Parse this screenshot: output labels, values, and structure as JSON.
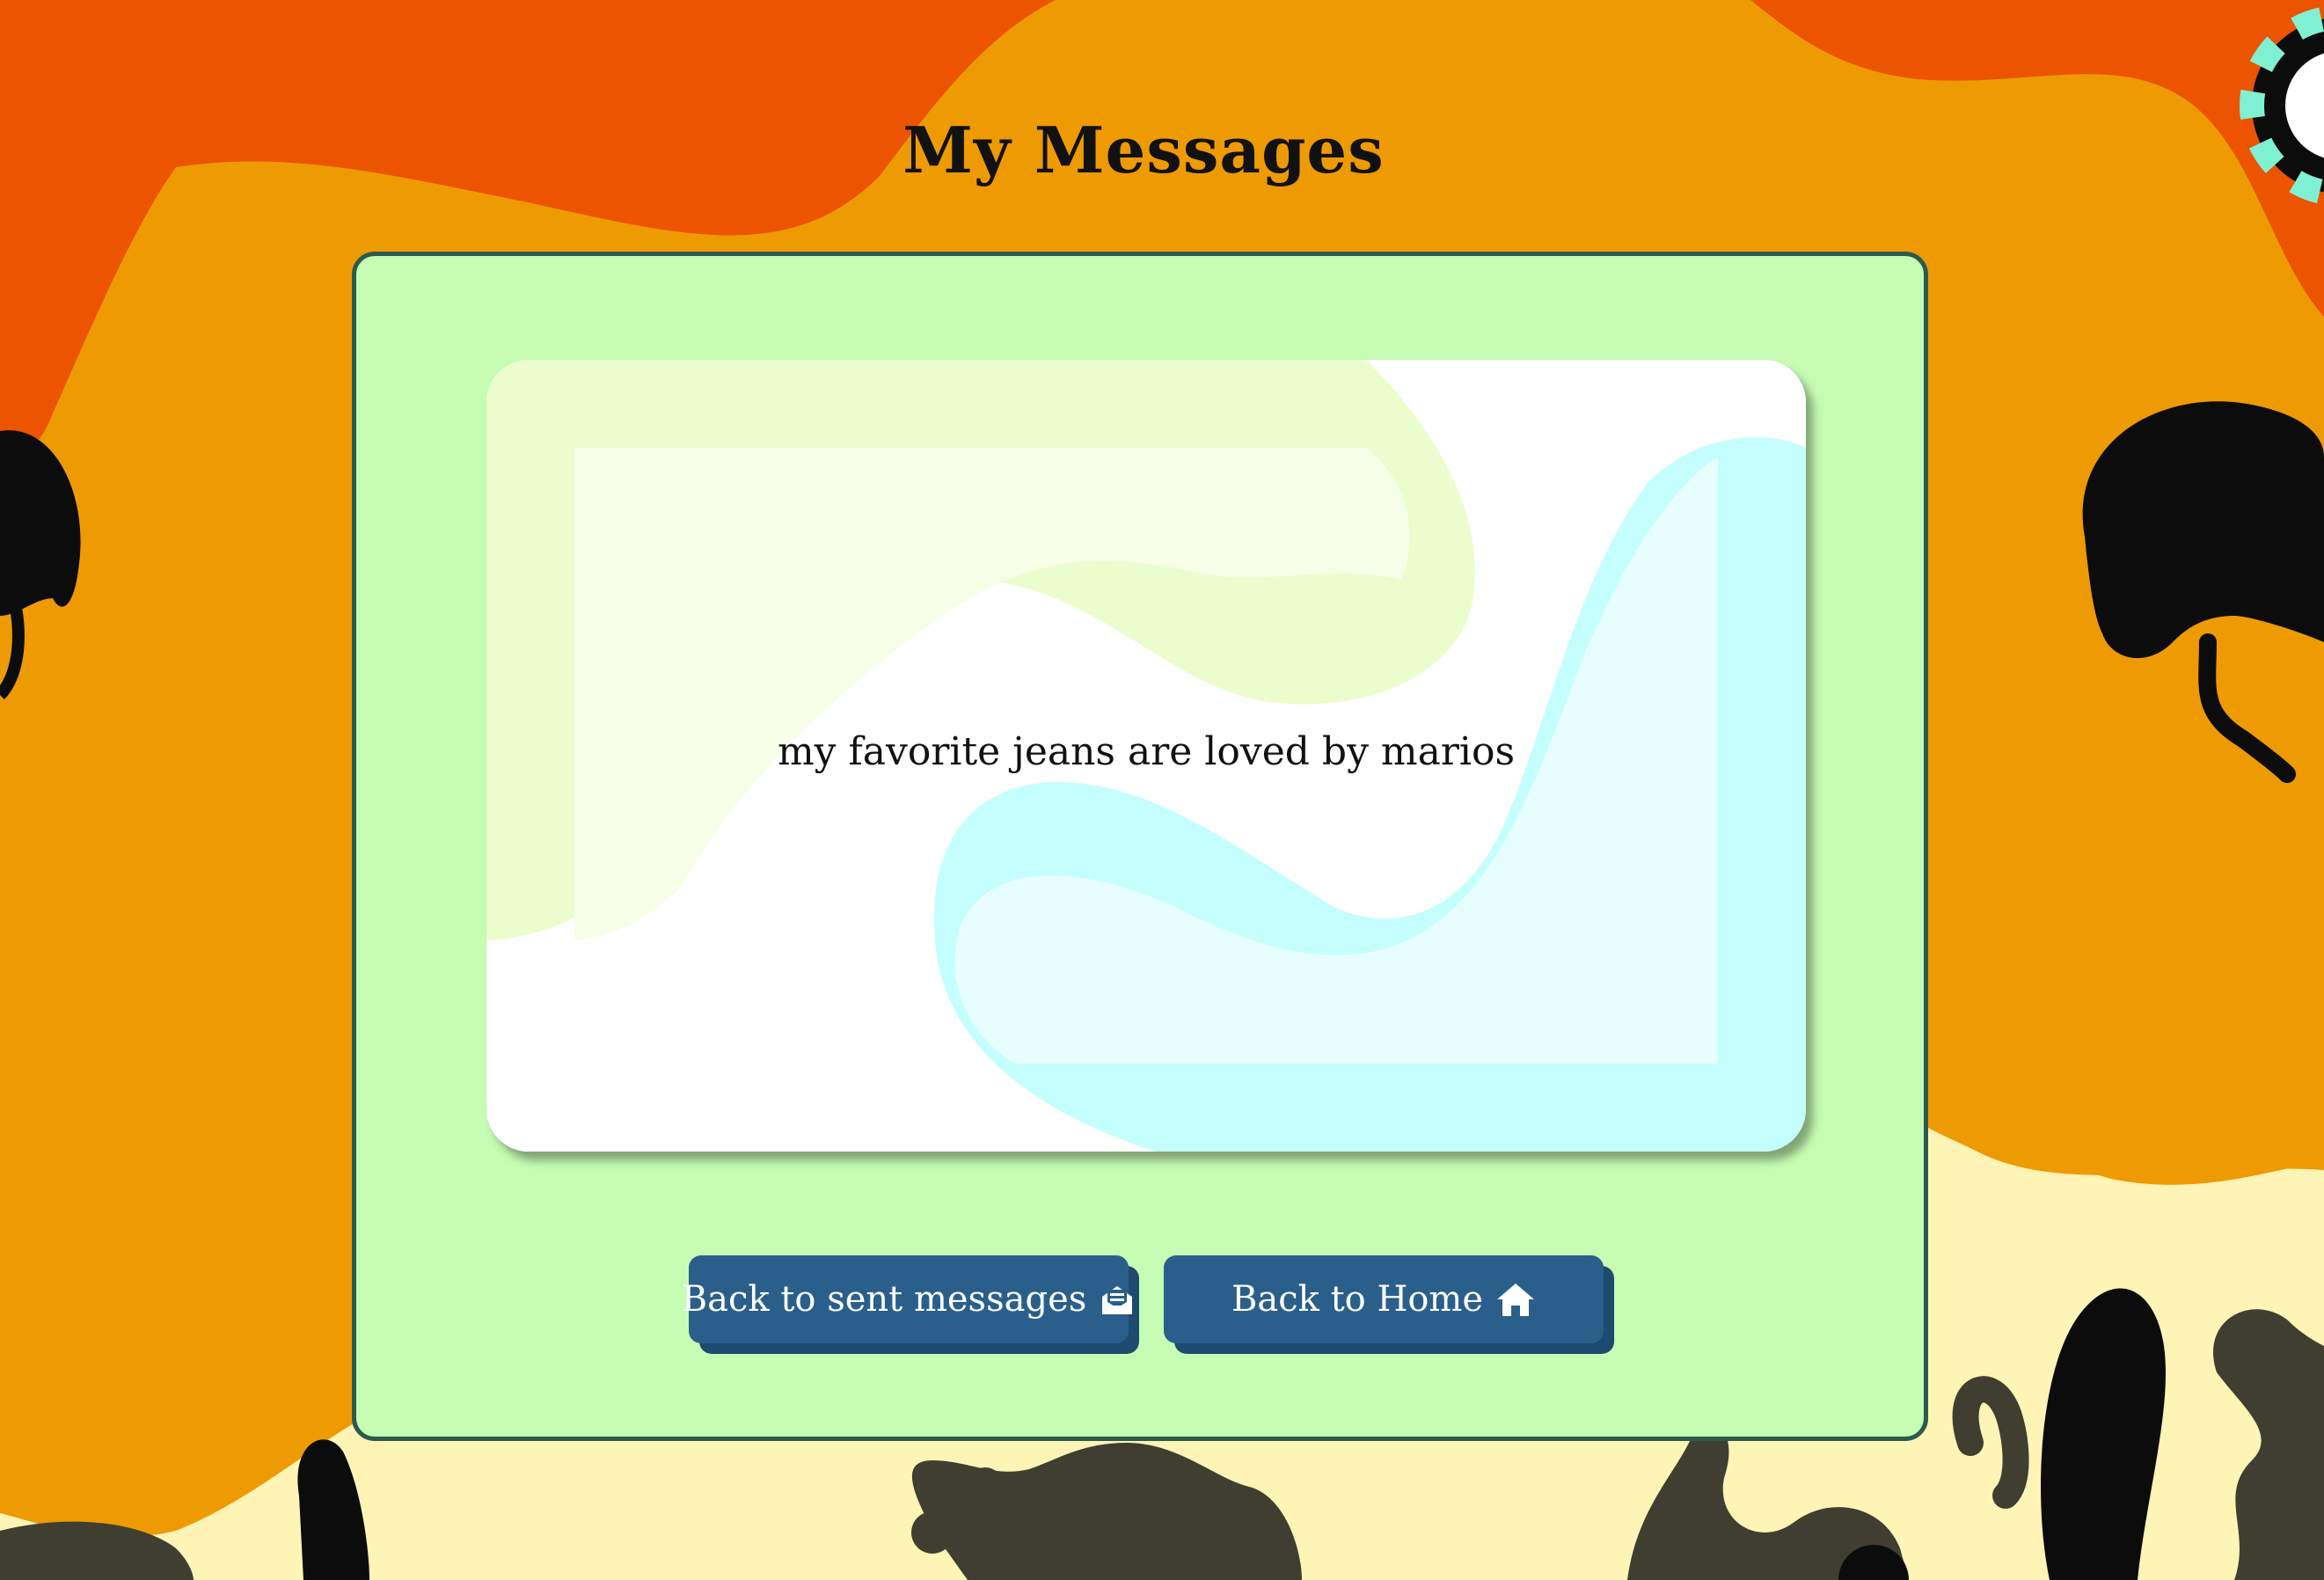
{
  "page": {
    "title": "My Messages"
  },
  "message": {
    "text": "my favorite jeans are loved by marios"
  },
  "buttons": {
    "back_sent_label": "Back to sent messages",
    "back_sent_icon": "envelope-open-icon",
    "back_home_label": "Back to Home",
    "back_home_icon": "home-icon"
  },
  "colors": {
    "panel_bg": "#c6fcb4",
    "panel_border": "#2b5a4e",
    "button_bg": "#2a5f8c",
    "button_shadow": "#1d4a6e",
    "bg_orange": "#ee9a03",
    "bg_red_orange": "#ec5400",
    "bg_cream": "#fef4b5"
  }
}
